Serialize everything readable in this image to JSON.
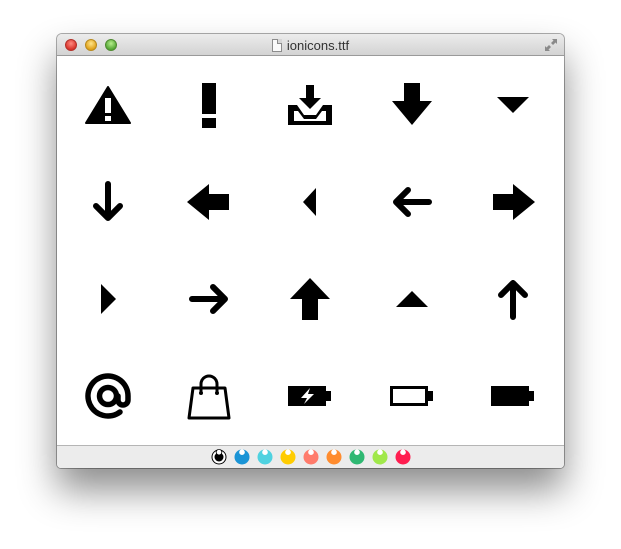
{
  "window": {
    "title": "ionicons.ttf",
    "controls": [
      "close",
      "minimize",
      "zoom"
    ],
    "fullscreen_icon": "fullscreen-icon"
  },
  "glyphs": [
    "alert-triangle",
    "exclamation",
    "download-tray",
    "arrow-down-thick",
    "caret-down",
    "arrow-down-thin",
    "arrow-left-thick",
    "caret-left",
    "arrow-left-thin",
    "arrow-right-thick",
    "caret-right",
    "arrow-right-thin",
    "arrow-up-thick",
    "caret-up",
    "arrow-up-thin",
    "at-sign",
    "shopping-bag",
    "battery-charging",
    "battery-empty",
    "battery-full"
  ],
  "swatches": {
    "selected": 0,
    "colors": [
      "#000000",
      "#1a94d6",
      "#4fd2e0",
      "#ffcc00",
      "#ff7b6b",
      "#ff8c2e",
      "#2fb872",
      "#a0e84a",
      "#ff1e50"
    ]
  }
}
